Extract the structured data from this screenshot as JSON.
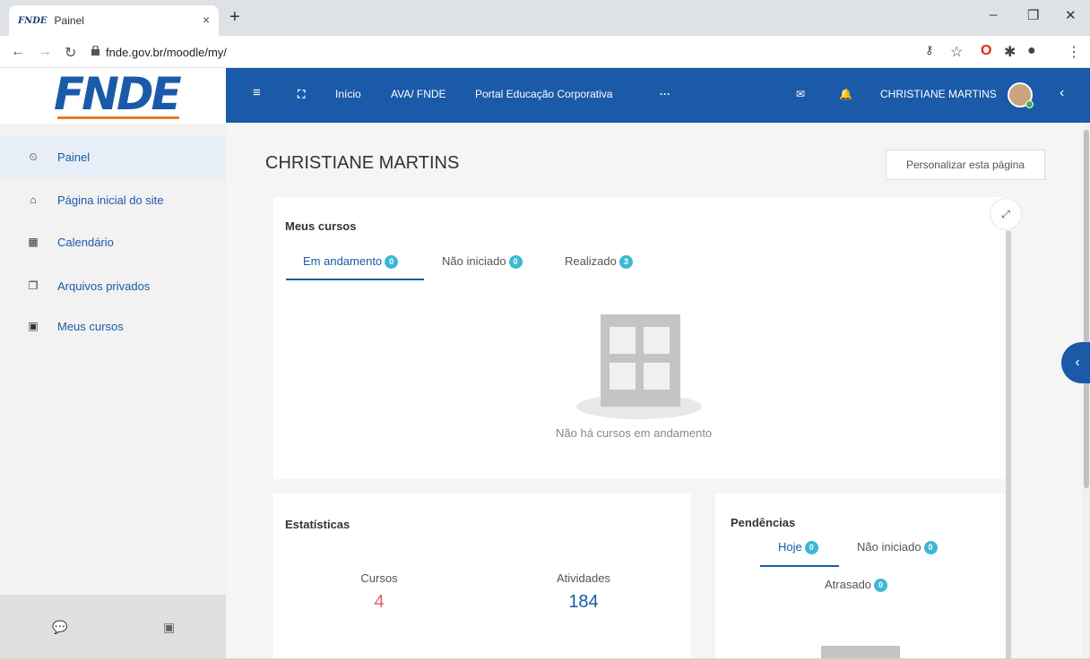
{
  "browser": {
    "tab_favicon_text": "FNDE",
    "tab_title": "Painel",
    "tab_close": "×",
    "new_tab": "+",
    "url": "fnde.gov.br/moodle/my/",
    "window_controls": [
      "–",
      "❐",
      "✕"
    ]
  },
  "sidebar": {
    "logo_text": "FNDE",
    "items": [
      {
        "label": "Painel",
        "icon": "dashboard-icon",
        "glyph": "⏲",
        "active": true
      },
      {
        "label": "Página inicial do site",
        "icon": "home-icon",
        "glyph": "⌂",
        "active": false
      },
      {
        "label": "Calendário",
        "icon": "calendar-icon",
        "glyph": "▦",
        "active": false
      },
      {
        "label": "Arquivos privados",
        "icon": "files-icon",
        "glyph": "❐",
        "active": false
      },
      {
        "label": "Meus cursos",
        "icon": "archive-icon",
        "glyph": "▣",
        "active": false
      }
    ],
    "bottom_icons": [
      "comments-icon",
      "archive-icon"
    ]
  },
  "navbar": {
    "items": [
      "Início",
      "AVA/ FNDE",
      "Portal Educação Corporativa",
      "···"
    ],
    "user_name": "CHRISTIANE MARTINS",
    "brand_color": "#1a5aa8"
  },
  "main": {
    "page_title": "CHRISTIANE MARTINS",
    "customize_label": "Personalizar esta página"
  },
  "my_courses": {
    "title": "Meus cursos",
    "tabs": [
      {
        "label": "Em andamento",
        "count": "0",
        "active": true
      },
      {
        "label": "Não iniciado",
        "count": "0",
        "active": false
      },
      {
        "label": "Realizado",
        "count": "3",
        "active": false
      }
    ],
    "empty_message": "Não há cursos em andamento"
  },
  "stats": {
    "title": "Estatísticas",
    "courses_label": "Cursos",
    "courses_value": "4",
    "activities_label": "Atividades",
    "activities_value": "184",
    "courses_color": "#e4605e",
    "activities_color": "#1a5aa8"
  },
  "pending": {
    "title": "Pendências",
    "tabs": [
      {
        "label": "Hoje",
        "count": "0",
        "active": true
      },
      {
        "label": "Não iniciado",
        "count": "0",
        "active": false
      },
      {
        "label": "Atrasado",
        "count": "0",
        "active": false
      }
    ]
  }
}
